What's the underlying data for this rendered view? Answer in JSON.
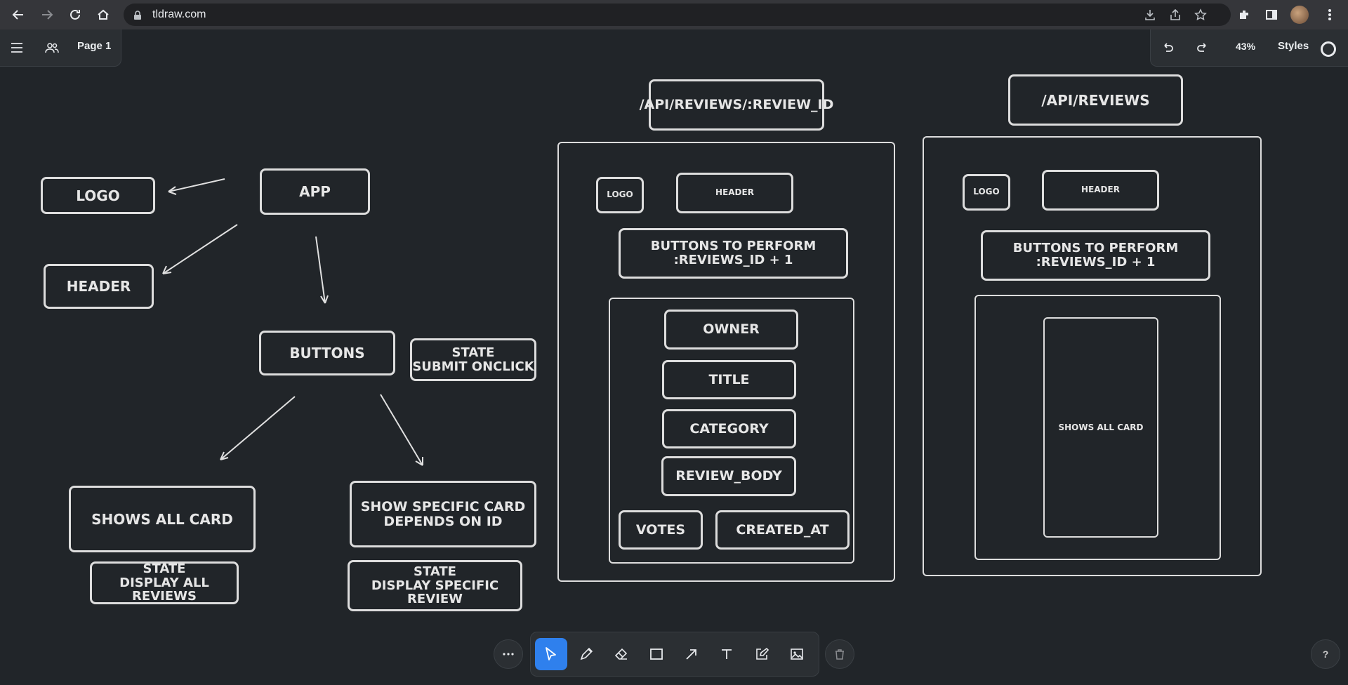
{
  "browser": {
    "url": "tldraw.com"
  },
  "app": {
    "page_name": "Page 1",
    "zoom": "43%",
    "styles_label": "Styles"
  },
  "diagram": {
    "logo": "LOGO",
    "app": "APP",
    "header": "HEADER",
    "buttons": "BUTTONS",
    "state_submit": "STATE\nSUBMIT ONCLICK",
    "shows_all": "SHOWS ALL CARD",
    "show_specific": "SHOW SPECIFIC CARD\nDEPENDS ON ID",
    "state_all": "STATE\nDISPLAY ALL REVIEWS",
    "state_specific": "STATE\nDISPLAY SPECIFIC REVIEW"
  },
  "review_id_page": {
    "route": "/API/REVIEWS/:REVIEW_ID",
    "logo": "LOGO",
    "header": "HEADER",
    "buttons": "BUTTONS TO PERFORM\n:REVIEWS_ID + 1",
    "owner": "OWNER",
    "title": "TITLE",
    "category": "CATEGORY",
    "review_body": "REVIEW_BODY",
    "votes": "VOTES",
    "created_at": "CREATED_AT"
  },
  "reviews_page": {
    "route": "/API/REVIEWS",
    "logo": "LOGO",
    "header": "HEADER",
    "buttons": "BUTTONS TO PERFORM\n:REVIEWS_ID + 1",
    "card": "SHOWS ALL CARD"
  },
  "help_label": "?"
}
